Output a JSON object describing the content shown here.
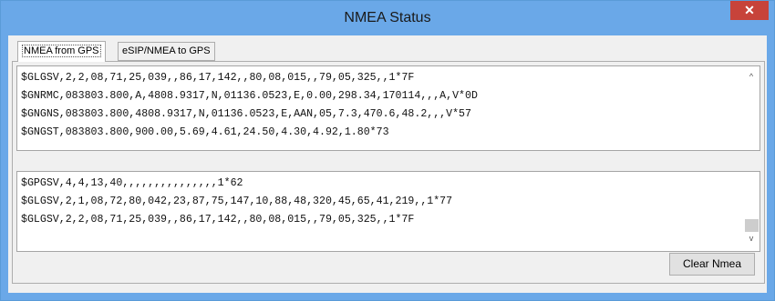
{
  "window": {
    "title": "NMEA Status",
    "close_glyph": "✕"
  },
  "tabs": [
    {
      "label": "NMEA from GPS",
      "active": true
    },
    {
      "label": "eSIP/NMEA to GPS",
      "active": false
    }
  ],
  "top_log": [
    "$GLGSV,2,2,08,71,25,039,,86,17,142,,80,08,015,,79,05,325,,1*7F",
    "$GNRMC,083803.800,A,4808.9317,N,01136.0523,E,0.00,298.34,170114,,,A,V*0D",
    "$GNGNS,083803.800,4808.9317,N,01136.0523,E,AAN,05,7.3,470.6,48.2,,,V*57",
    "$GNGST,083803.800,900.00,5.69,4.61,24.50,4.30,4.92,1.80*73"
  ],
  "bottom_log": [
    "$GPGSV,4,4,13,40,,,,,,,,,,,,,,,1*62",
    "$GLGSV,2,1,08,72,80,042,23,87,75,147,10,88,48,320,45,65,41,219,,1*77",
    "$GLGSV,2,2,08,71,25,039,,86,17,142,,80,08,015,,79,05,325,,1*7F"
  ],
  "scroll": {
    "up_glyph": "^",
    "down_glyph": "v"
  },
  "clear_button": "Clear Nmea"
}
